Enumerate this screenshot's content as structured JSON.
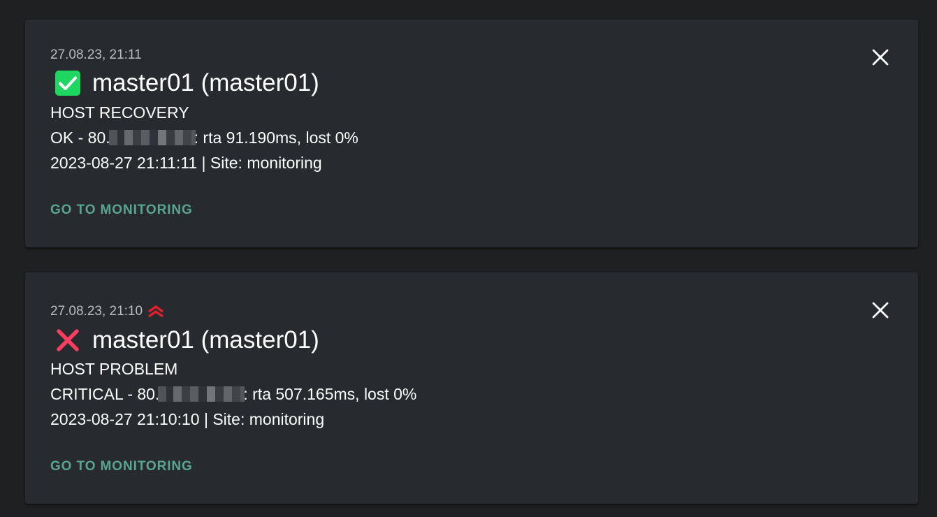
{
  "notifications": [
    {
      "timestamp": "27.08.23, 21:11",
      "status": "ok",
      "status_color": "#1ed760",
      "icon": "check-icon",
      "title": "master01 (master01)",
      "state": "HOST RECOVERY",
      "output_prefix": "OK - 80.",
      "output_suffix": ": rta 91.190ms, lost 0%",
      "meta": "2023-08-27 21:11:11 | Site: monitoring",
      "action_label": "GO TO MONITORING",
      "high_priority": false
    },
    {
      "timestamp": "27.08.23, 21:10",
      "status": "critical",
      "status_color": "#ff3d5f",
      "icon": "cross-icon",
      "title": "master01 (master01)",
      "state": "HOST PROBLEM",
      "output_prefix": "CRITICAL - 80.",
      "output_suffix": ": rta 507.165ms, lost 0%",
      "meta": "2023-08-27 21:10:10 | Site: monitoring",
      "action_label": "GO TO MONITORING",
      "high_priority": true,
      "priority_color": "#e0202a"
    }
  ],
  "colors": {
    "background": "#1f2021",
    "card": "#272b2f",
    "link": "#5aa58f"
  }
}
